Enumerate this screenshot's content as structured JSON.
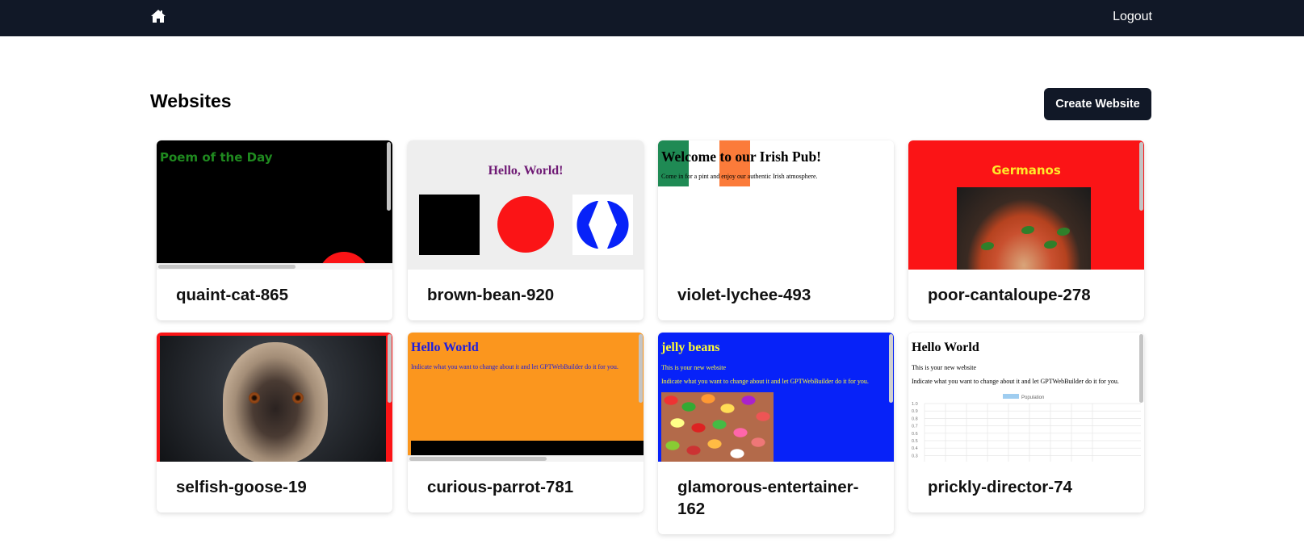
{
  "navbar": {
    "home_icon": "home-icon",
    "logout_label": "Logout"
  },
  "page": {
    "title": "Websites",
    "create_button_label": "Create Website"
  },
  "colors": {
    "navbar_bg": "#111827",
    "button_bg": "#111827"
  },
  "websites": [
    {
      "name": "quaint-cat-865",
      "preview": {
        "heading": "Poem of the Day"
      }
    },
    {
      "name": "brown-bean-920",
      "preview": {
        "heading": "Hello, World!"
      }
    },
    {
      "name": "violet-lychee-493",
      "preview": {
        "heading": "Welcome to our Irish Pub!",
        "text": "Come in for a pint and enjoy our authentic Irish atmosphere."
      }
    },
    {
      "name": "poor-cantaloupe-278",
      "preview": {
        "heading": "Germanos"
      }
    },
    {
      "name": "selfish-goose-19",
      "preview": {
        "image": "pug-photo"
      }
    },
    {
      "name": "curious-parrot-781",
      "preview": {
        "heading": "Hello World",
        "text": "Indicate what you want to change about it and let GPTWebBuilder do it for you."
      }
    },
    {
      "name": "glamorous-entertainer-162",
      "preview": {
        "heading": "jelly beans",
        "text1": "This is your new website",
        "text2": "Indicate what you want to change about it and let GPTWebBuilder do it for you."
      }
    },
    {
      "name": "prickly-director-74",
      "preview": {
        "heading": "Hello World",
        "text1": "This is your new website",
        "text2": "Indicate what you want to change about it and let GPTWebBuilder do it for you.",
        "chart_legend": "Population",
        "chart_y_ticks": [
          "1.0",
          "0.9",
          "0.8",
          "0.7",
          "0.6",
          "0.5",
          "0.4",
          "0.3"
        ]
      }
    }
  ]
}
